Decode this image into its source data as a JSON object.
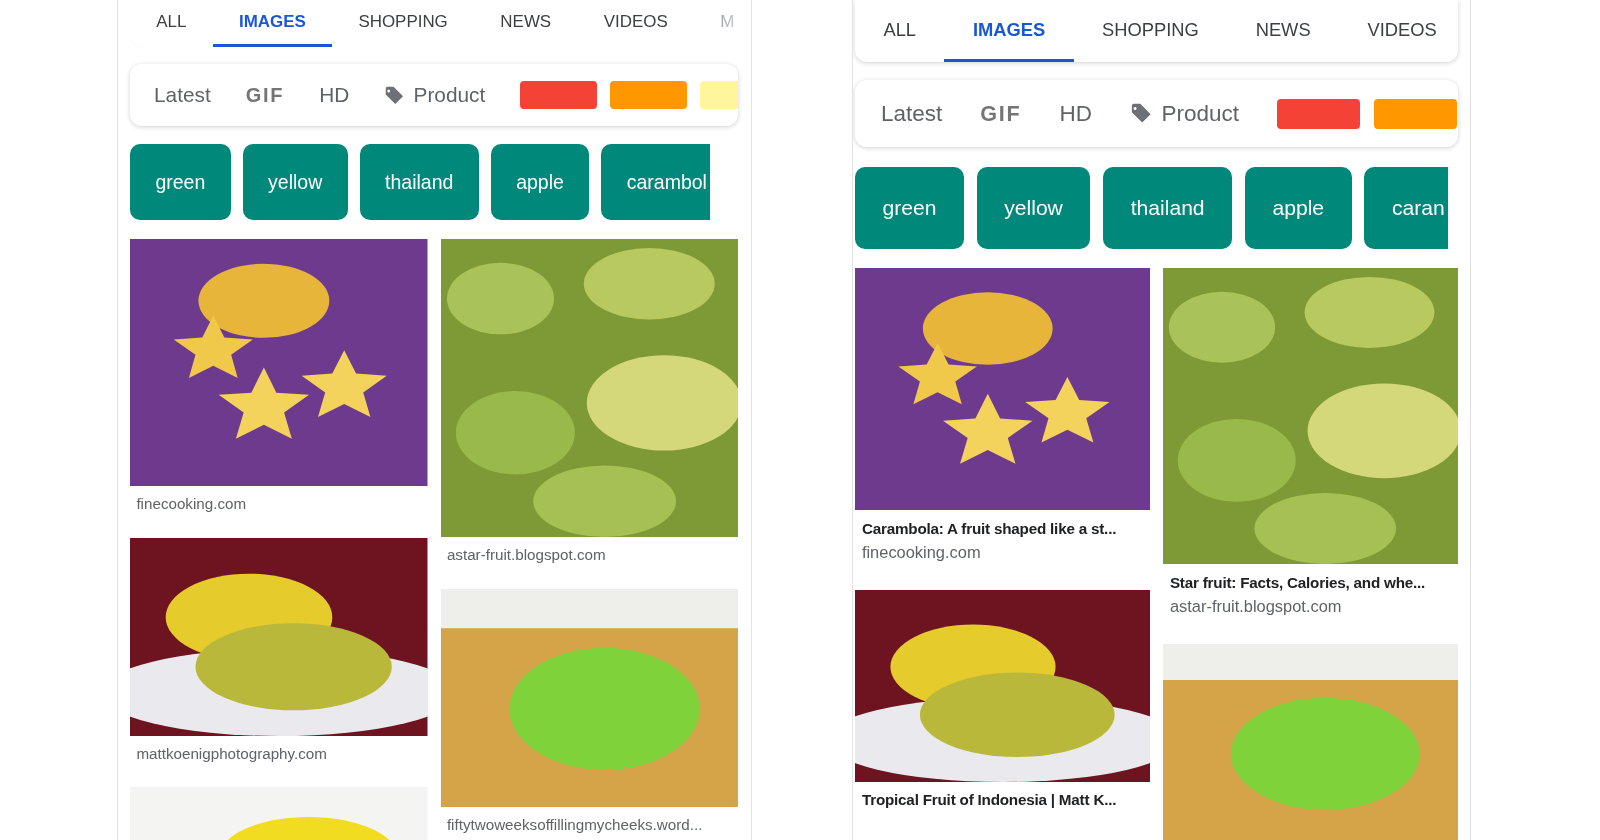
{
  "screens": [
    {
      "tabs": [
        {
          "label": "ALL",
          "selected": false
        },
        {
          "label": "IMAGES",
          "selected": true
        },
        {
          "label": "SHOPPING",
          "selected": false
        },
        {
          "label": "NEWS",
          "selected": false
        },
        {
          "label": "VIDEOS",
          "selected": false
        },
        {
          "label": "M",
          "selected": false
        }
      ],
      "filters": [
        {
          "kind": "text",
          "label": "Latest"
        },
        {
          "kind": "gif",
          "label": "GIF"
        },
        {
          "kind": "text",
          "label": "HD"
        },
        {
          "kind": "tag",
          "label": "Product"
        },
        {
          "kind": "swatch",
          "color": "#f44336"
        },
        {
          "kind": "swatch",
          "color": "#ff9800"
        },
        {
          "kind": "swatch",
          "color": "#fff59d"
        }
      ],
      "chips": [
        "green",
        "yellow",
        "thailand",
        "apple",
        "carambol"
      ],
      "columns": [
        [
          {
            "kind": "slices",
            "source": "finecooking.com"
          },
          {
            "kind": "plate",
            "source": "mattkoenigphotography.com"
          },
          {
            "kind": "whole"
          }
        ],
        [
          {
            "kind": "pile",
            "source": "astar-fruit.blogspot.com"
          },
          {
            "kind": "board",
            "source": "fiftytwoweeksoffillingmycheeks.word..."
          }
        ]
      ]
    },
    {
      "tabs": [
        {
          "label": "ALL",
          "selected": false
        },
        {
          "label": "IMAGES",
          "selected": true
        },
        {
          "label": "SHOPPING",
          "selected": false
        },
        {
          "label": "NEWS",
          "selected": false
        },
        {
          "label": "VIDEOS",
          "selected": false
        }
      ],
      "filters": [
        {
          "kind": "text",
          "label": "Latest"
        },
        {
          "kind": "gif",
          "label": "GIF"
        },
        {
          "kind": "text",
          "label": "HD"
        },
        {
          "kind": "tag",
          "label": "Product"
        },
        {
          "kind": "swatch",
          "color": "#f44336"
        },
        {
          "kind": "swatch",
          "color": "#ff9800"
        }
      ],
      "chips": [
        "green",
        "yellow",
        "thailand",
        "apple",
        "caran"
      ],
      "columns": [
        [
          {
            "kind": "slices",
            "title": "Carambola: A fruit shaped like a st...",
            "source": "finecooking.com"
          },
          {
            "kind": "plate",
            "title": "Tropical Fruit of Indonesia | Matt K..."
          }
        ],
        [
          {
            "kind": "pile",
            "title": "Star fruit: Facts, Calories, and whe...",
            "source": "astar-fruit.blogspot.com"
          },
          {
            "kind": "board"
          }
        ]
      ]
    }
  ]
}
